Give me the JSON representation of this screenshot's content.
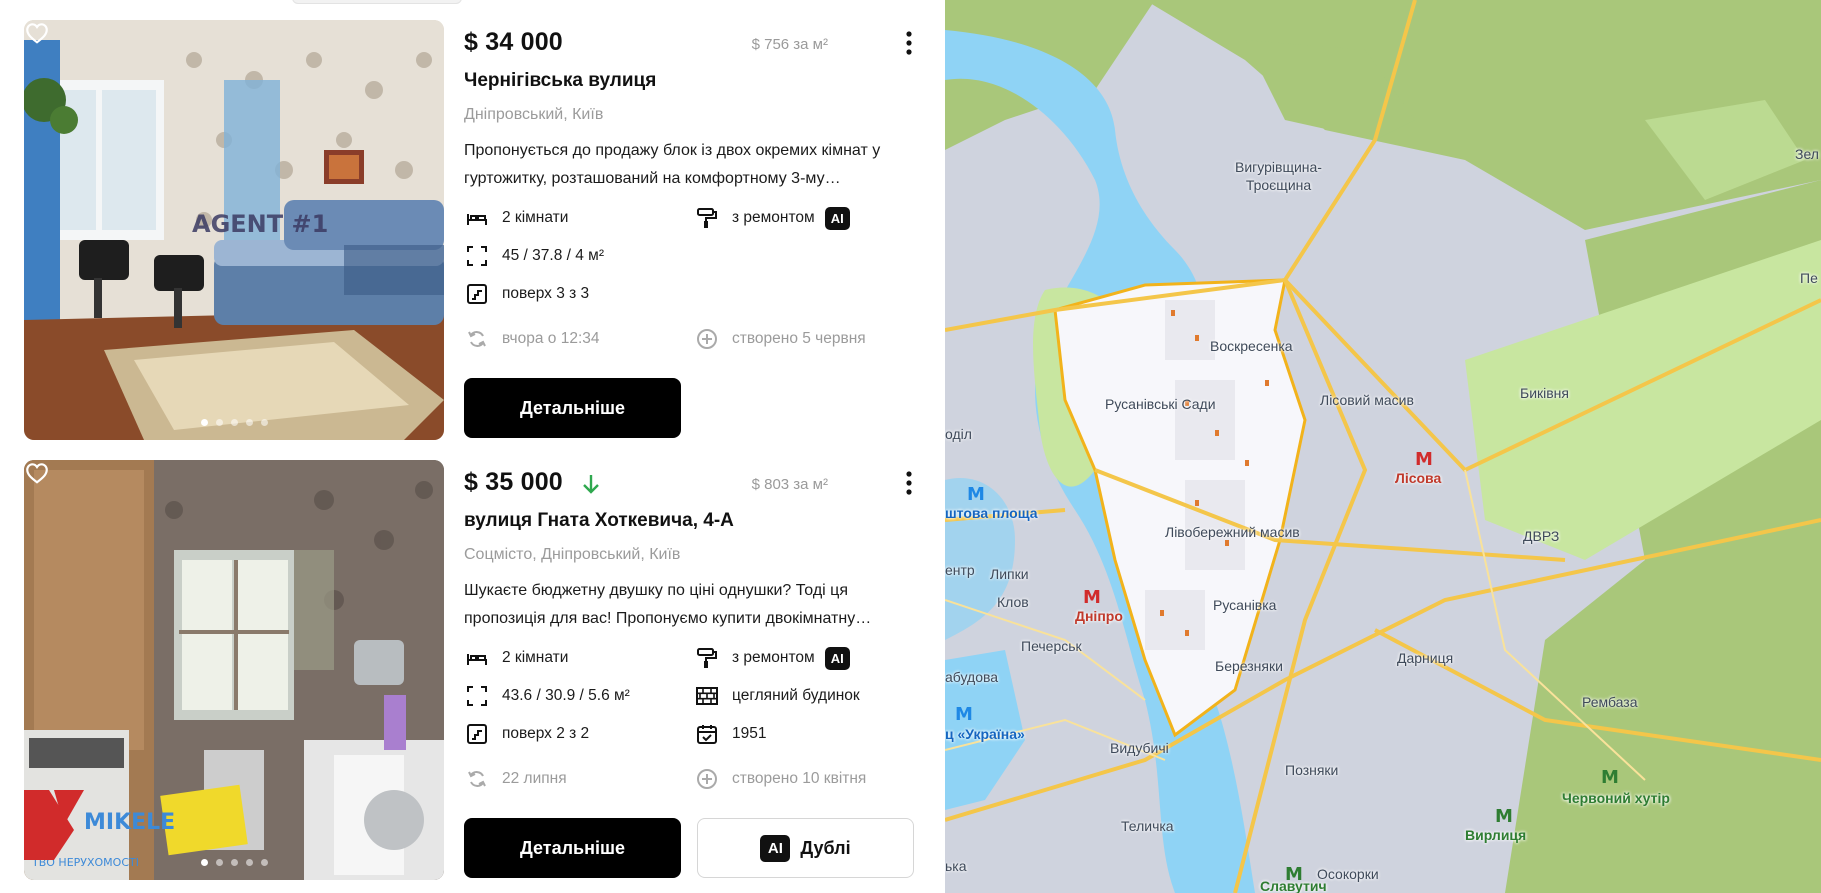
{
  "listings": [
    {
      "price": "$ 34 000",
      "price_per_m2": "$ 756 за м²",
      "title": "Чернігівська вулиця",
      "address": "Дніпровський, Київ",
      "description_line1": "Пропонується до продажу блок із двох окремих кімнат у",
      "description_line2": "гуртожитку, розташований на комфортному 3-му…",
      "rooms": "2 кімнати",
      "area": "45 / 37.8 / 4 м²",
      "floor": "поверх 3 з 3",
      "renovation": "з ремонтом",
      "ai_badge": "AI",
      "updated": "вчора о 12:34",
      "created": "створено 5 червня",
      "details_label": "Детальніше",
      "watermark": "AGENT #1",
      "photo_dots": 5,
      "active_dot": 0
    },
    {
      "price": "$ 35 000",
      "price_trend": "down",
      "price_per_m2": "$ 803 за м²",
      "title": "вулиця Гната Хоткевича, 4-А",
      "address": "Соцмісто, Дніпровський, Київ",
      "description_line1": "Шукаєте бюджетну двушку по ціні однушки? Тоді ця",
      "description_line2": "пропозиція для вас! Пропонуємо купити двокімнатну…",
      "rooms": "2 кімнати",
      "area": "43.6 / 30.9 / 5.6 м²",
      "floor": "поверх 2 з 2",
      "renovation": "з ремонтом",
      "building": "цегляний будинок",
      "year": "1951",
      "ai_badge": "AI",
      "updated": "22 липня",
      "created": "створено 10 квітня",
      "details_label": "Детальніше",
      "duplicates_label": "Дублі",
      "watermark": "MIKELE",
      "watermark_sub": "ТВО НЕРУХОМОСТІ",
      "photo_dots": 5,
      "active_dot": 0
    }
  ],
  "map": {
    "labels": {
      "troieshchyna": "Вигурівщина-\nТроєщина",
      "voskresenka": "Воскресенка",
      "rusanivski_sady": "Русанівські Сади",
      "lisovyi_masyv": "Лісовий масив",
      "bykivnia": "Биківня",
      "lisova": "Лісова",
      "livoberezhnyi": "Лівобережний масив",
      "dvrz": "ДВРЗ",
      "rusanivka": "Русанівка",
      "dnipro": "Дніпро",
      "lypky": "Липки",
      "klov": "Клов",
      "pechersk": "Печерськ",
      "bereznyaky": "Березняки",
      "darnytsia": "Дарниця",
      "rembaza": "Рембаза",
      "vydubychi": "Видубичі",
      "pozniaky": "Позняки",
      "chervonyi_khutir": "Червоний хутір",
      "vyrlytsia": "Вирлиця",
      "teremky_label": "Теличка",
      "osokorky": "Осокорки",
      "slavutych": "Славутич",
      "edge_podil": "оділ",
      "edge_ploshcha": "штова площа",
      "edge_tsentr": "ентр",
      "edge_budova": "абудова",
      "edge_ukraina": "ц «Україна»",
      "edge_ka": "ька",
      "edge_zel": "Зел",
      "edge_pe": "Пе"
    },
    "colors": {
      "water": "#8fd3f5",
      "urban": "#cdd2de",
      "park": "#c8e6a0",
      "forest": "#a9c77a",
      "road": "#f4c64a",
      "highlight_fill": "#f7f7fb",
      "highlight_border": "#f2b31b"
    }
  }
}
